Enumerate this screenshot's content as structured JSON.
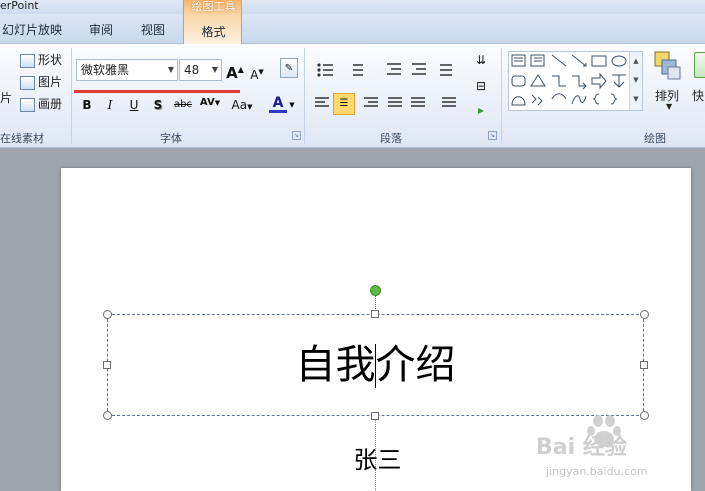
{
  "app": {
    "title": "erPoint"
  },
  "tabs": {
    "slideshow": "幻灯片放映",
    "review": "审阅",
    "view": "视图"
  },
  "contextual": {
    "group_title": "绘图工具",
    "tab": "格式"
  },
  "online_group": {
    "items": [
      {
        "label": "形状"
      },
      {
        "label": "图片"
      },
      {
        "label": "画册"
      }
    ],
    "left_labels": [
      "片"
    ],
    "label": "在线素材"
  },
  "font_group": {
    "font_name": "微软雅黑",
    "font_size": "48",
    "grow": "A",
    "shrink": "A",
    "bold": "B",
    "italic": "I",
    "underline": "U",
    "shadow": "S",
    "strike": "abc",
    "spacing": "AV",
    "case": "Aa",
    "color": "A",
    "label": "字体"
  },
  "paragraph_group": {
    "label": "段落"
  },
  "drawing_group": {
    "arrange": "排列",
    "quick": "快",
    "label": "绘图"
  },
  "slide": {
    "title": "自我介绍",
    "subtitle": "张三"
  },
  "watermark": {
    "brand": "Bai 经验",
    "url": "jingyan.baidu.com"
  },
  "colors": {
    "accent": "#f6b56d",
    "highlight": "#ffd76d",
    "underline_mark": "#e3393b",
    "rotate_handle": "#5bbc43"
  }
}
